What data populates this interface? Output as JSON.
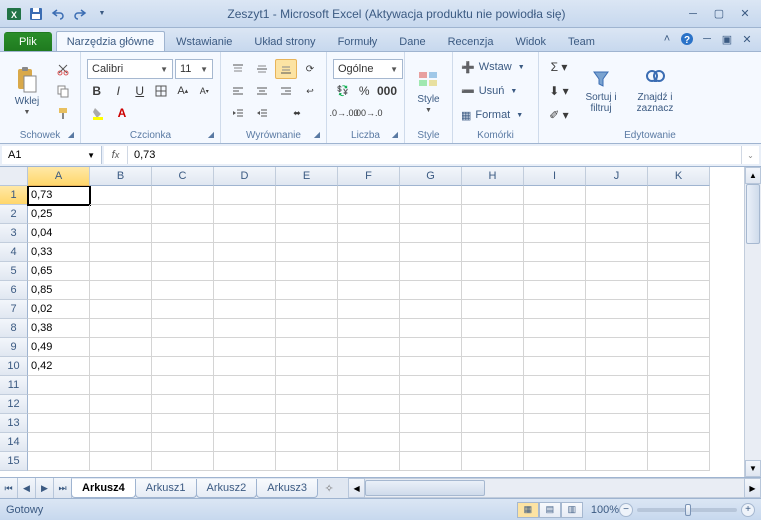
{
  "title": "Zeszyt1 - Microsoft Excel (Aktywacja produktu nie powiodła się)",
  "tabs": {
    "file": "Plik",
    "items": [
      "Narzędzia główne",
      "Wstawianie",
      "Układ strony",
      "Formuły",
      "Dane",
      "Recenzja",
      "Widok",
      "Team"
    ],
    "active_index": 0
  },
  "ribbon": {
    "clipboard": {
      "label": "Schowek",
      "paste": "Wklej"
    },
    "font": {
      "label": "Czcionka",
      "name": "Calibri",
      "size": "11"
    },
    "alignment": {
      "label": "Wyrównanie"
    },
    "number": {
      "label": "Liczba",
      "format": "Ogólne"
    },
    "styles": {
      "label": "Style",
      "btn": "Style"
    },
    "cells": {
      "label": "Komórki",
      "insert": "Wstaw",
      "delete": "Usuń",
      "format": "Format"
    },
    "editing": {
      "label": "Edytowanie",
      "sort": "Sortuj i\nfiltruj",
      "find": "Znajdź i\nzaznacz"
    }
  },
  "namebox": "A1",
  "formula": "0,73",
  "columns": [
    "A",
    "B",
    "C",
    "D",
    "E",
    "F",
    "G",
    "H",
    "I",
    "J",
    "K"
  ],
  "rows": [
    1,
    2,
    3,
    4,
    5,
    6,
    7,
    8,
    9,
    10,
    11,
    12,
    13,
    14,
    15
  ],
  "cells": {
    "A1": "0,73",
    "A2": "0,25",
    "A3": "0,04",
    "A4": "0,33",
    "A5": "0,65",
    "A6": "0,85",
    "A7": "0,02",
    "A8": "0,38",
    "A9": "0,49",
    "A10": "0,42"
  },
  "selected_cell": "A1",
  "sheets": {
    "items": [
      "Arkusz4",
      "Arkusz1",
      "Arkusz2",
      "Arkusz3"
    ],
    "active_index": 0
  },
  "status": {
    "ready": "Gotowy",
    "zoom": "100%"
  }
}
